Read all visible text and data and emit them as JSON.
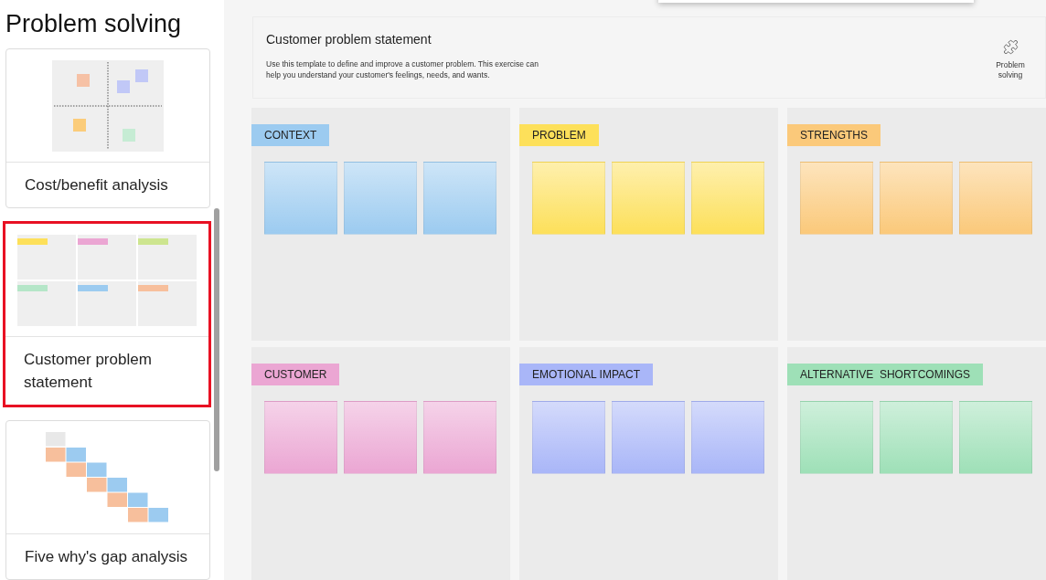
{
  "sidebar": {
    "title": "Problem solving",
    "templates": [
      {
        "title": "Cost/benefit analysis",
        "kind": "quadrant",
        "selected": false
      },
      {
        "title": "Customer problem statement",
        "kind": "grid",
        "selected": true
      },
      {
        "title": "Five why's gap analysis",
        "kind": "staircase",
        "selected": false
      }
    ]
  },
  "header": {
    "title": "Customer problem statement",
    "description": "Use this template to define and improve a customer problem. This exercise can help you understand your customer's feelings, needs, and wants.",
    "category": "Problem solving"
  },
  "sections": [
    {
      "label": "CONTEXT",
      "color": "#9ccbf0"
    },
    {
      "label": "PROBLEM",
      "color": "#fde05a"
    },
    {
      "label": "STRENGTHS",
      "color": "#fbc97a"
    },
    {
      "label": "CUSTOMER",
      "color": "#eba6d3"
    },
    {
      "label": "EMOTIONAL IMPACT",
      "color": "#a9b6f8"
    },
    {
      "label": "ALTERNATIVE  SHORTCOMINGS",
      "color": "#9ee0b7"
    }
  ]
}
